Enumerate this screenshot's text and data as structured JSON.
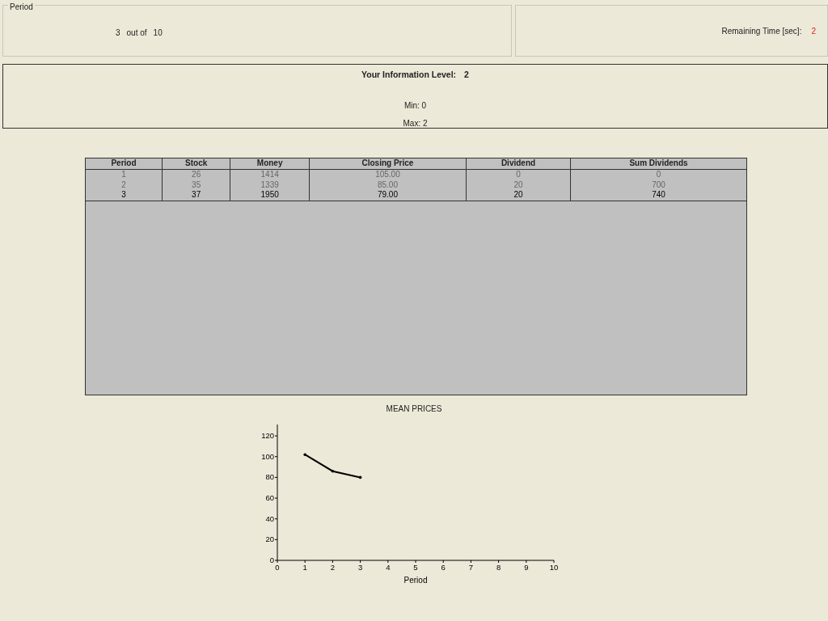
{
  "period_panel": {
    "legend": "Period",
    "current": "3",
    "out_of": "out of",
    "total": "10"
  },
  "timer_panel": {
    "label": "Remaining Time [sec]:",
    "value": "2"
  },
  "info_panel": {
    "title": "Your Information Level:",
    "level": "2",
    "min": "Min: 0",
    "max": "Max: 2"
  },
  "table": {
    "columns": [
      "Period",
      "Stock",
      "Money",
      "Closing Price",
      "Dividend",
      "Sum Dividends"
    ],
    "rows": [
      {
        "cells": [
          "1",
          "26",
          "1414",
          "105.00",
          "0",
          "0"
        ],
        "current": false
      },
      {
        "cells": [
          "2",
          "35",
          "1339",
          "85.00",
          "20",
          "700"
        ],
        "current": false
      },
      {
        "cells": [
          "3",
          "37",
          "1950",
          "79.00",
          "20",
          "740"
        ],
        "current": true
      }
    ]
  },
  "chart": {
    "chart_data": {
      "type": "line",
      "title": "MEAN PRICES",
      "xlabel": "Period",
      "x": [
        1,
        2,
        3
      ],
      "series": [
        {
          "color": "#000000",
          "values": [
            102,
            86,
            80
          ]
        }
      ],
      "xlim": [
        0,
        10
      ],
      "ylim": [
        0,
        131
      ],
      "xticks": [
        0,
        1,
        2,
        3,
        4,
        5,
        6,
        7,
        8,
        9,
        10
      ],
      "yticks": [
        0,
        20,
        40,
        60,
        80,
        100,
        120
      ]
    }
  }
}
